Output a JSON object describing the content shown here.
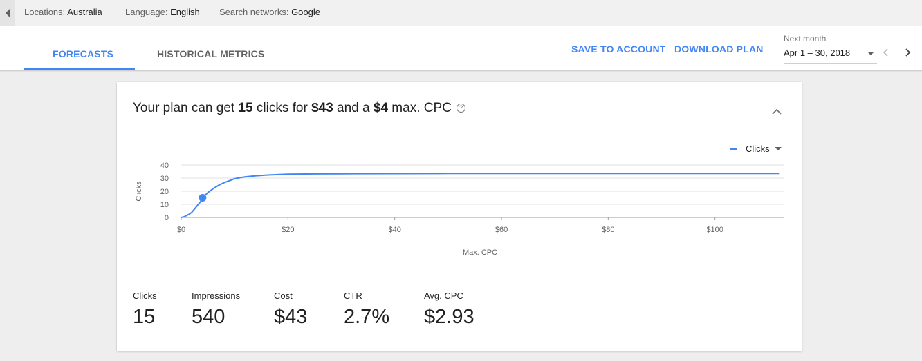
{
  "filters": {
    "locations_label": "Locations:",
    "locations_value": "Australia",
    "language_label": "Language:",
    "language_value": "English",
    "networks_label": "Search networks:",
    "networks_value": "Google"
  },
  "tabs": [
    {
      "label": "FORECASTS",
      "active": true
    },
    {
      "label": "HISTORICAL METRICS",
      "active": false
    }
  ],
  "actions": {
    "save_label": "SAVE TO ACCOUNT",
    "download_label": "DOWNLOAD PLAN"
  },
  "date_range": {
    "caption": "Next month",
    "value": "Apr 1 – 30, 2018"
  },
  "card": {
    "headline": {
      "prefix": "Your plan can get ",
      "clicks": "15",
      "mid1": " clicks for ",
      "cost": "$43",
      "mid2": " and a ",
      "cpc": "$4",
      "suffix": " max. CPC",
      "help_glyph": "?"
    }
  },
  "legend": {
    "label": "Clicks"
  },
  "colors": {
    "accent": "#4285f4",
    "line": "#4285f4",
    "grid": "#e0e0e0"
  },
  "chart_data": {
    "type": "line",
    "title": "",
    "xlabel": "Max. CPC",
    "ylabel": "Clicks",
    "xlim": [
      0,
      113
    ],
    "ylim": [
      0,
      40
    ],
    "x_ticks": [
      0,
      20,
      40,
      60,
      80,
      100
    ],
    "x_tick_labels": [
      "$0",
      "$20",
      "$40",
      "$60",
      "$80",
      "$100"
    ],
    "y_ticks": [
      0,
      10,
      20,
      30,
      40
    ],
    "y_tick_labels": [
      "0",
      "10",
      "20",
      "30",
      "40"
    ],
    "grid": true,
    "legend_position": "top-right",
    "series": [
      {
        "name": "Clicks",
        "x": [
          0,
          0.5,
          1,
          1.5,
          2,
          2.5,
          3,
          3.5,
          4,
          4.5,
          5,
          6,
          7,
          8,
          9,
          10,
          11,
          12,
          14,
          16,
          18,
          20,
          25,
          30,
          40,
          50,
          60,
          80,
          100,
          112
        ],
        "y": [
          0,
          0.5,
          1.5,
          2.5,
          4,
          6.5,
          9,
          11.5,
          14,
          17,
          19,
          22,
          24.5,
          26.5,
          28,
          29.5,
          30.3,
          31,
          31.8,
          32.3,
          32.7,
          33,
          33.2,
          33.3,
          33.4,
          33.5,
          33.5,
          33.5,
          33.5,
          33.5
        ]
      }
    ],
    "highlight_point": {
      "x": 4,
      "y": 15
    }
  },
  "metrics": [
    {
      "label": "Clicks",
      "value": "15"
    },
    {
      "label": "Impressions",
      "value": "540"
    },
    {
      "label": "Cost",
      "value": "$43"
    },
    {
      "label": "CTR",
      "value": "2.7%"
    },
    {
      "label": "Avg. CPC",
      "value": "$2.93"
    }
  ]
}
